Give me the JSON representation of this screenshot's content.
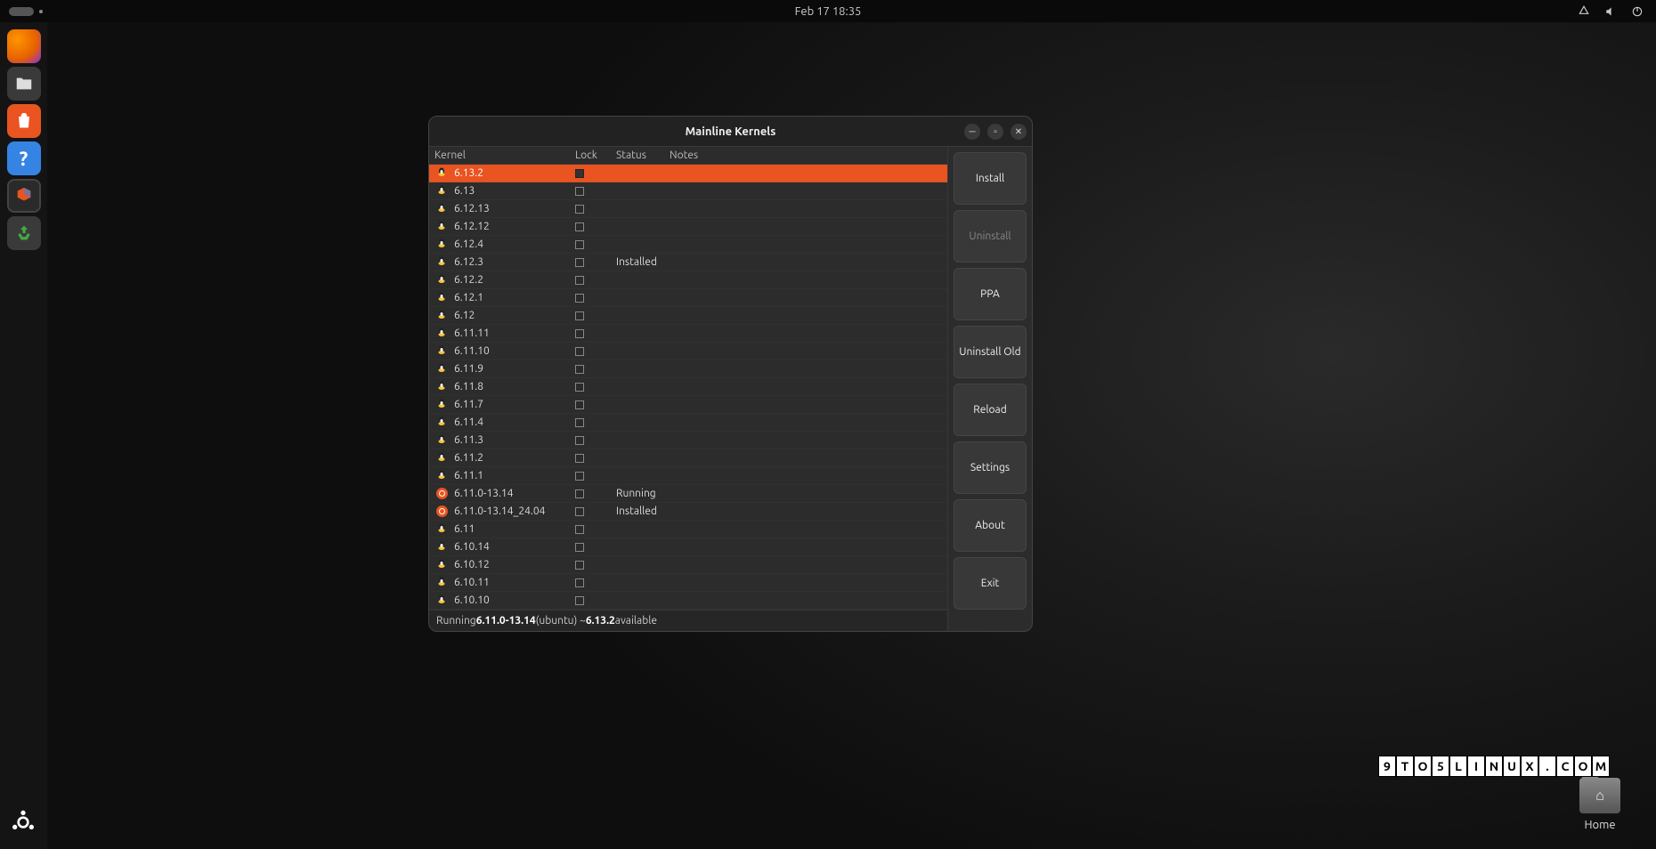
{
  "topbar": {
    "clock": "Feb 17  18:35"
  },
  "dock": {
    "activities": "activities"
  },
  "desktop": {
    "home_label": "Home"
  },
  "watermark": [
    "9",
    "T",
    "O",
    "5",
    "L",
    "I",
    "N",
    "U",
    "X",
    ".",
    "C",
    "O",
    "M"
  ],
  "window": {
    "title": "Mainline Kernels",
    "headers": {
      "kernel": "Kernel",
      "lock": "Lock",
      "status": "Status",
      "notes": "Notes"
    },
    "rows": [
      {
        "name": "6.13.2",
        "icon": "tux",
        "status": "",
        "selected": true
      },
      {
        "name": "6.13",
        "icon": "tux",
        "status": ""
      },
      {
        "name": "6.12.13",
        "icon": "tux",
        "status": ""
      },
      {
        "name": "6.12.12",
        "icon": "tux",
        "status": ""
      },
      {
        "name": "6.12.4",
        "icon": "tux",
        "status": ""
      },
      {
        "name": "6.12.3",
        "icon": "tux",
        "status": "Installed"
      },
      {
        "name": "6.12.2",
        "icon": "tux",
        "status": ""
      },
      {
        "name": "6.12.1",
        "icon": "tux",
        "status": ""
      },
      {
        "name": "6.12",
        "icon": "tux",
        "status": ""
      },
      {
        "name": "6.11.11",
        "icon": "tux",
        "status": ""
      },
      {
        "name": "6.11.10",
        "icon": "tux",
        "status": ""
      },
      {
        "name": "6.11.9",
        "icon": "tux",
        "status": ""
      },
      {
        "name": "6.11.8",
        "icon": "tux",
        "status": ""
      },
      {
        "name": "6.11.7",
        "icon": "tux",
        "status": ""
      },
      {
        "name": "6.11.4",
        "icon": "tux",
        "status": ""
      },
      {
        "name": "6.11.3",
        "icon": "tux",
        "status": ""
      },
      {
        "name": "6.11.2",
        "icon": "tux",
        "status": ""
      },
      {
        "name": "6.11.1",
        "icon": "tux",
        "status": ""
      },
      {
        "name": "6.11.0-13.14",
        "icon": "ubuntu",
        "status": "Running"
      },
      {
        "name": "6.11.0-13.14_24.04",
        "icon": "ubuntu",
        "status": "Installed"
      },
      {
        "name": "6.11",
        "icon": "tux",
        "status": ""
      },
      {
        "name": "6.10.14",
        "icon": "tux",
        "status": ""
      },
      {
        "name": "6.10.12",
        "icon": "tux",
        "status": ""
      },
      {
        "name": "6.10.11",
        "icon": "tux",
        "status": ""
      },
      {
        "name": "6.10.10",
        "icon": "tux",
        "status": ""
      }
    ],
    "statusbar": {
      "prefix": "Running ",
      "running": "6.11.0-13.14",
      "mid": " (ubuntu) ~ ",
      "avail": "6.13.2",
      "suffix": " available"
    },
    "buttons": {
      "install": "Install",
      "uninstall": "Uninstall",
      "ppa": "PPA",
      "uninstall_old": "Uninstall Old",
      "reload": "Reload",
      "settings": "Settings",
      "about": "About",
      "exit": "Exit"
    }
  }
}
